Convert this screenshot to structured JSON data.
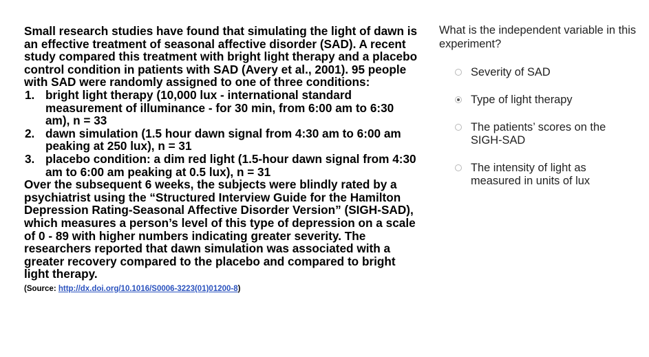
{
  "passage": {
    "intro": "Small research studies have found that simulating the light of dawn is an effective treatment of seasonal affective disorder (SAD). A recent study compared this treatment with bright light therapy and a placebo control condition in patients with SAD (Avery et al., 2001). 95 people with SAD were randomly assigned to one of three conditions:",
    "conditions": [
      {
        "number": "1.",
        "text": "bright light therapy (10,000 lux - international standard measurement of illuminance - for 30 min, from 6:00 am to 6:30 am), n = 33"
      },
      {
        "number": "2.",
        "text": "dawn simulation (1.5 hour dawn signal from 4:30 am to 6:00 am peaking at 250 lux), n = 31"
      },
      {
        "number": "3.",
        "text": "placebo condition: a dim red light (1.5-hour dawn signal from 4:30 am to 6:00 am peaking at 0.5 lux), n = 31"
      }
    ],
    "outro": "Over the subsequent 6 weeks, the subjects were blindly rated by a psychiatrist using the “Structured Interview Guide for the Hamilton Depression Rating-Seasonal Affective Disorder Version” (SIGH-SAD), which measures a person’s level of this type of depression on a scale of 0 - 89 with higher numbers indicating greater severity. The researchers reported that dawn simulation was associated with a greater recovery compared to the placebo and compared to bright light therapy.",
    "source_prefix": "(Source: ",
    "source_link": "http://dx.doi.org/10.1016/S0006-3223(01)01200-8",
    "source_suffix": ")"
  },
  "question": {
    "text": "What is the independent variable in this experiment?",
    "options": [
      {
        "label": "Severity of SAD",
        "selected": false
      },
      {
        "label": "Type of light therapy",
        "selected": true
      },
      {
        "label": "The patients’ scores on the SIGH-SAD",
        "selected": false
      },
      {
        "label": "The intensity of light as measured in units of lux",
        "selected": false
      }
    ]
  },
  "colors": {
    "passage_text": "#000000",
    "question_text": "#222222",
    "link": "#2a52be",
    "radio_border": "#b8b8b8",
    "radio_dot": "#555555"
  }
}
